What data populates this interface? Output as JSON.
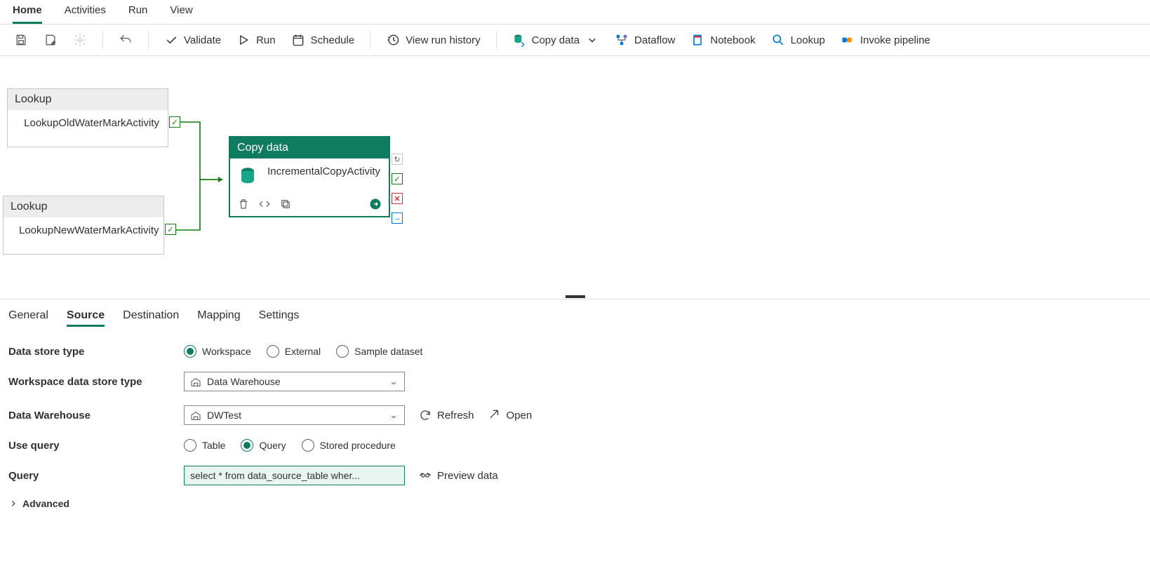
{
  "menu": {
    "tabs": [
      "Home",
      "Activities",
      "Run",
      "View"
    ],
    "active": "Home"
  },
  "toolbar": {
    "validate": "Validate",
    "run": "Run",
    "schedule": "Schedule",
    "view_run_history": "View run history",
    "copy_data": "Copy data",
    "dataflow": "Dataflow",
    "notebook": "Notebook",
    "lookup": "Lookup",
    "invoke_pipeline": "Invoke pipeline"
  },
  "activities": {
    "lookup_old": {
      "type": "Lookup",
      "name": "LookupOldWaterMarkActivity"
    },
    "lookup_new": {
      "type": "Lookup",
      "name": "LookupNewWaterMarkActivity"
    },
    "copy_data": {
      "type": "Copy data",
      "name": "IncrementalCopyActivity"
    }
  },
  "bottom_tabs": [
    "General",
    "Source",
    "Destination",
    "Mapping",
    "Settings"
  ],
  "bottom_active": "Source",
  "form": {
    "data_store_type": {
      "label": "Data store type",
      "options": [
        "Workspace",
        "External",
        "Sample dataset"
      ],
      "selected": "Workspace"
    },
    "workspace_data_store_type": {
      "label": "Workspace data store type",
      "value": "Data Warehouse"
    },
    "data_warehouse": {
      "label": "Data Warehouse",
      "value": "DWTest",
      "refresh": "Refresh",
      "open": "Open"
    },
    "use_query": {
      "label": "Use query",
      "options": [
        "Table",
        "Query",
        "Stored procedure"
      ],
      "selected": "Query"
    },
    "query": {
      "label": "Query",
      "value": "select * from data_source_table wher...",
      "preview": "Preview data"
    },
    "advanced": "Advanced"
  }
}
